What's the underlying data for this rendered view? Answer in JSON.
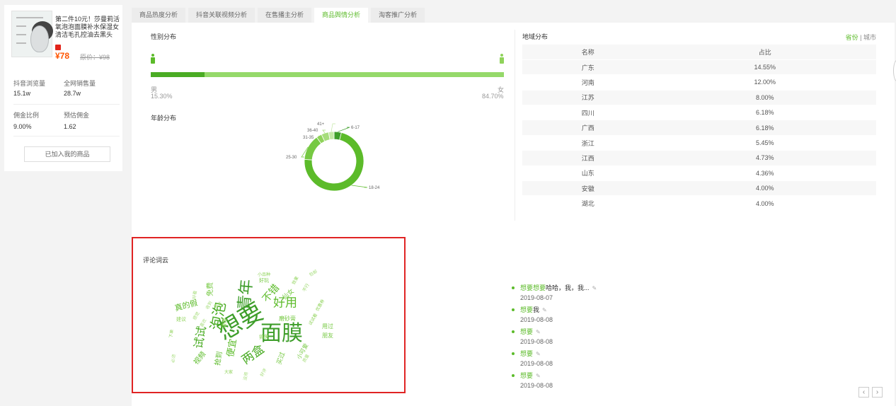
{
  "product": {
    "thumb_caption": "绿豆面膜精华原液",
    "title": "第二件10元！莎曼莉活氧泡泡面膜补水保湿女清洁毛孔控油去黑头",
    "price": "¥78",
    "original_price": "原价：¥98",
    "stats": [
      {
        "label": "抖音浏览量",
        "value": "15.1w"
      },
      {
        "label": "全网销售量",
        "value": "28.7w"
      },
      {
        "label": "佣金比例",
        "value": "9.00%"
      },
      {
        "label": "预估佣金",
        "value": "1.62"
      }
    ],
    "added_label": "已加入我的商品"
  },
  "tabs": [
    {
      "label": "商品热度分析",
      "active": false
    },
    {
      "label": "抖音关联视频分析",
      "active": false
    },
    {
      "label": "在售播主分析",
      "active": false
    },
    {
      "label": "商品舆情分析",
      "active": true
    },
    {
      "label": "淘客推广分析",
      "active": false
    }
  ],
  "gender": {
    "title": "性别分布",
    "male_label": "男",
    "male_pct": "15.30%",
    "female_label": "女",
    "female_pct": "84.70%",
    "male_fraction": 0.153
  },
  "age": {
    "title": "年龄分布",
    "chart_data": {
      "type": "pie",
      "categories": [
        "6-17",
        "18-24",
        "25-30",
        "31-35",
        "36-40",
        "41+"
      ],
      "values": [
        4,
        72,
        14,
        3,
        4,
        3
      ],
      "colors": [
        "#3e9e2a",
        "#5cbb2a",
        "#76c943",
        "#8fd35a",
        "#a6dd7b",
        "#c2e8a4"
      ]
    }
  },
  "region": {
    "title": "地域分布",
    "switch_on": "省份",
    "switch_sep": "|",
    "switch_off": "城市",
    "col_name": "名称",
    "col_pct": "占比",
    "rows": [
      {
        "name": "广东",
        "pct": "14.55%"
      },
      {
        "name": "河南",
        "pct": "12.00%"
      },
      {
        "name": "江苏",
        "pct": "8.00%"
      },
      {
        "name": "四川",
        "pct": "6.18%"
      },
      {
        "name": "广西",
        "pct": "6.18%"
      },
      {
        "name": "浙江",
        "pct": "5.45%"
      },
      {
        "name": "江西",
        "pct": "4.73%"
      },
      {
        "name": "山东",
        "pct": "4.36%"
      },
      {
        "name": "安徽",
        "pct": "4.00%"
      },
      {
        "name": "湖北",
        "pct": "4.00%"
      }
    ]
  },
  "cloud": {
    "title": "评论词云",
    "words": [
      {
        "t": "想要",
        "s": 34,
        "c": "#3e9e2a",
        "r": -30
      },
      {
        "t": "面膜",
        "s": 30,
        "c": "#3e9e2a",
        "r": 0
      },
      {
        "t": "青年",
        "s": 22,
        "c": "#3e9e2a",
        "r": -85
      },
      {
        "t": "泡泡",
        "s": 20,
        "c": "#4aac24",
        "r": -80
      },
      {
        "t": "好用",
        "s": 17,
        "c": "#5cbb2a",
        "r": 0
      },
      {
        "t": "试试",
        "s": 16,
        "c": "#4aac24",
        "r": -80
      },
      {
        "t": "两盒",
        "s": 17,
        "c": "#4aac24",
        "r": -35
      },
      {
        "t": "不错",
        "s": 14,
        "c": "#5cbb2a",
        "r": -50
      },
      {
        "t": "真的假",
        "s": 11,
        "c": "#5cbb2a",
        "r": -15
      },
      {
        "t": "便宜",
        "s": 13,
        "c": "#5cbb2a",
        "r": -80
      },
      {
        "t": "抢到",
        "s": 10,
        "c": "#5cbb2a",
        "r": -80
      },
      {
        "t": "视频",
        "s": 10,
        "c": "#5cbb2a",
        "r": -50
      },
      {
        "t": "免费",
        "s": 10,
        "c": "#76c943",
        "r": -90
      },
      {
        "t": "磨砂膏",
        "s": 8,
        "c": "#76c943",
        "r": 0
      },
      {
        "t": "仙女",
        "s": 9,
        "c": "#76c943",
        "r": -40
      },
      {
        "t": "用过",
        "s": 8,
        "c": "#76c943",
        "r": 0
      },
      {
        "t": "朋友",
        "s": 8,
        "c": "#76c943",
        "r": 0
      },
      {
        "t": "小可爱",
        "s": 8,
        "c": "#76c943",
        "r": -60
      },
      {
        "t": "好玩",
        "s": 7,
        "c": "#76c943",
        "r": 0
      },
      {
        "t": "小品种",
        "s": 6,
        "c": "#8fd35a",
        "r": 0
      },
      {
        "t": "建议",
        "s": 7,
        "c": "#8fd35a",
        "r": 0
      },
      {
        "t": "买过",
        "s": 9,
        "c": "#76c943",
        "r": -70
      },
      {
        "t": "值得",
        "s": 7,
        "c": "#8fd35a",
        "r": -80
      },
      {
        "t": "搞笑",
        "s": 7,
        "c": "#8fd35a",
        "r": 0
      },
      {
        "t": "大家",
        "s": 6,
        "c": "#8fd35a",
        "r": 0
      },
      {
        "t": "效果",
        "s": 6,
        "c": "#8fd35a",
        "r": -60
      },
      {
        "t": "不行",
        "s": 6,
        "c": "#8fd35a",
        "r": -60
      },
      {
        "t": "下单",
        "s": 6,
        "c": "#8fd35a",
        "r": -80
      },
      {
        "t": "优惠券",
        "s": 6,
        "c": "#8fd35a",
        "r": -60
      },
      {
        "t": "试试看",
        "s": 6,
        "c": "#8fd35a",
        "r": -60
      },
      {
        "t": "质量",
        "s": 6,
        "c": "#a6dd7b",
        "r": -60
      },
      {
        "t": "没用",
        "s": 6,
        "c": "#a6dd7b",
        "r": -80
      },
      {
        "t": "好看",
        "s": 6,
        "c": "#a6dd7b",
        "r": -80
      },
      {
        "t": "感觉",
        "s": 6,
        "c": "#a6dd7b",
        "r": -60
      },
      {
        "t": "喜欢",
        "s": 6,
        "c": "#a6dd7b",
        "r": -60
      },
      {
        "t": "收到",
        "s": 6,
        "c": "#a6dd7b",
        "r": -60
      },
      {
        "t": "清洁",
        "s": 6,
        "c": "#a6dd7b",
        "r": -30
      },
      {
        "t": "好评",
        "s": 6,
        "c": "#a6dd7b",
        "r": -60
      },
      {
        "t": "必须",
        "s": 6,
        "c": "#a6dd7b",
        "r": -80
      },
      {
        "t": "包邮",
        "s": 6,
        "c": "#a6dd7b",
        "r": -30
      }
    ]
  },
  "comments": [
    {
      "highlight": "想要想要",
      "rest": "哈哈，我，我...",
      "date": "2019-08-07"
    },
    {
      "highlight": "想要",
      "rest": "我",
      "date": "2019-08-08"
    },
    {
      "highlight": "想要",
      "rest": "",
      "date": "2019-08-08"
    },
    {
      "highlight": "想要",
      "rest": "",
      "date": "2019-08-08"
    },
    {
      "highlight": "想要",
      "rest": "",
      "date": "2019-08-08"
    }
  ],
  "pager": {
    "prev": "‹",
    "next": "›"
  },
  "icons": {
    "edit": "✎"
  }
}
